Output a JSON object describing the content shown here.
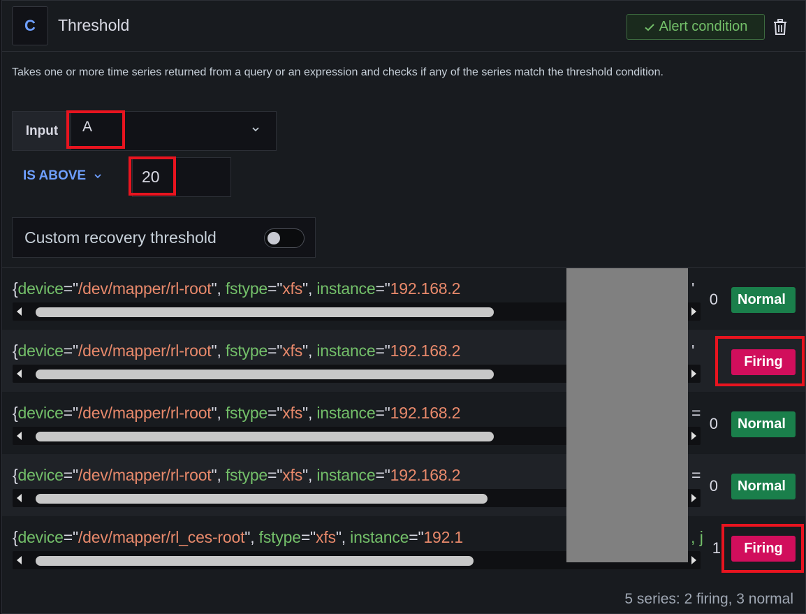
{
  "header": {
    "ref_id": "C",
    "title": "Threshold",
    "alert_condition_label": "Alert condition",
    "alert_check_icon": "check-icon",
    "delete_icon": "trash-icon"
  },
  "description": "Takes one or more time series returned from a query or an expression and checks if any of the series match the threshold condition.",
  "input": {
    "label": "Input",
    "value": "A",
    "chevron_icon": "chevron-down-icon"
  },
  "condition": {
    "operator": "IS ABOVE",
    "value": "20"
  },
  "recovery": {
    "label": "Custom recovery threshold",
    "enabled": false
  },
  "series": [
    {
      "device": "/dev/mapper/rl-root",
      "fstype": "xfs",
      "instance_prefix": "192.168.2",
      "trail": "'",
      "value": "0",
      "state": "Normal",
      "scroll_fraction": 0.68
    },
    {
      "device": "/dev/mapper/rl-root",
      "fstype": "xfs",
      "instance_prefix": "192.168.2",
      "trail": "'",
      "value": "",
      "state": "Firing",
      "scroll_fraction": 0.68
    },
    {
      "device": "/dev/mapper/rl-root",
      "fstype": "xfs",
      "instance_prefix": "192.168.2",
      "trail": "=",
      "value": "0",
      "state": "Normal",
      "scroll_fraction": 0.68
    },
    {
      "device": "/dev/mapper/rl-root",
      "fstype": "xfs",
      "instance_prefix": "192.168.2",
      "trail": "=",
      "value": "0",
      "state": "Normal",
      "scroll_fraction": 0.67
    },
    {
      "device": "/dev/mapper/rl_ces-root",
      "fstype": "xfs",
      "instance_prefix": "192.1",
      "trail": ", j",
      "value": "1",
      "state": "Firing",
      "scroll_fraction": 0.65
    }
  ],
  "summary": "5 series: 2 firing, 3 normal",
  "colors": {
    "label_key": "#73bf69",
    "label_value": "#e8896b",
    "normal": "#1a7f4b",
    "firing": "#d10e5c",
    "accent": "#6e9fff",
    "highlight": "#e8141f"
  }
}
